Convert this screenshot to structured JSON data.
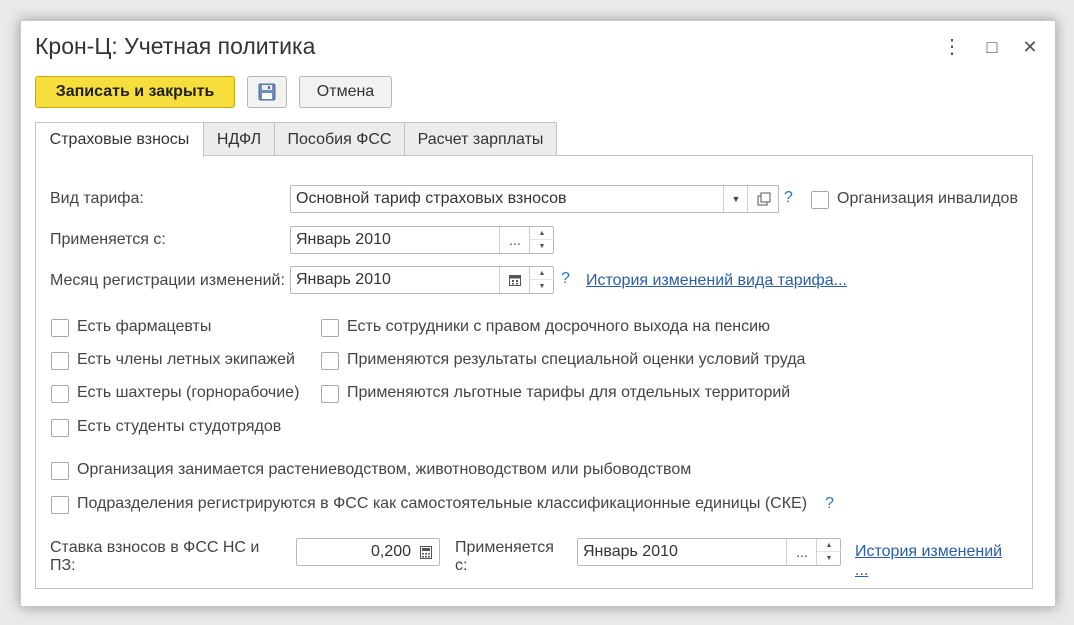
{
  "window": {
    "title": "Крон-Ц: Учетная политика",
    "menu_icon": "⋮",
    "maximize_icon": "□",
    "close_icon": "✕"
  },
  "toolbar": {
    "save_close_label": "Записать и закрыть",
    "save_icon": "floppy-disk-icon",
    "cancel_label": "Отмена"
  },
  "tabs": [
    {
      "label": "Страховые взносы",
      "active": true
    },
    {
      "label": "НДФЛ",
      "active": false
    },
    {
      "label": "Пособия ФСС",
      "active": false
    },
    {
      "label": "Расчет зарплаты",
      "active": false
    }
  ],
  "form": {
    "tariff_label": "Вид тарифа:",
    "tariff_value": "Основной тариф страховых взносов",
    "tariff_help": "?",
    "disabled_org_label": "Организация инвалидов",
    "applies_from_label": "Применяется с:",
    "applies_from_value": "Январь 2010",
    "reg_month_label": "Месяц регистрации изменений:",
    "reg_month_value": "Январь 2010",
    "reg_month_help": "?",
    "tariff_history_link": "История изменений вида тарифа...",
    "ellipsis": "...",
    "checkboxes_left": [
      "Есть фармацевты",
      "Есть члены летных экипажей",
      "Есть шахтеры (горнорабочие)",
      "Есть студенты студотрядов"
    ],
    "checkboxes_right": [
      "Есть сотрудники с правом досрочного выхода на пенсию",
      "Применяются результаты специальной оценки условий труда",
      "Применяются льготные тарифы для отдельных территорий"
    ],
    "agriculture_label": "Организация занимается растениеводством, животноводством или рыбоводством",
    "fss_units_label": "Подразделения регистрируются в ФСС как самостоятельные классификационные единицы (СКЕ)",
    "fss_units_help": "?",
    "fss_rate_label_1": "Ставка взносов в ФСС НС и",
    "fss_rate_label_2": "ПЗ:",
    "fss_rate_value": "0,200",
    "fss_applies_label_1": "Применяется",
    "fss_applies_label_2": "с:",
    "fss_applies_value": "Январь 2010",
    "history_link_1": "История изменений",
    "history_link_2": "..."
  }
}
